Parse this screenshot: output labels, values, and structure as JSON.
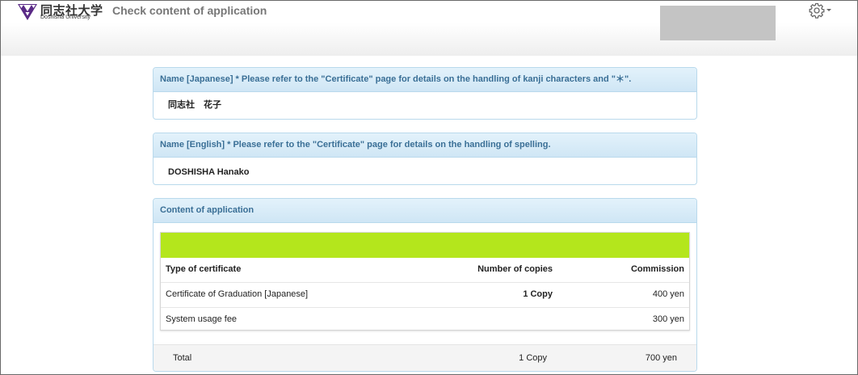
{
  "header": {
    "logo_ja": "同志社大学",
    "logo_en": "Doshisha University",
    "page_title": "Check content of application",
    "settings_icon": "gear-icon"
  },
  "name_japanese": {
    "heading": "Name [Japanese] * Please refer to the \"Certificate\" page for details on the handling of kanji characters and \"＊\".",
    "value": "同志社　花子"
  },
  "name_english": {
    "heading": "Name [English] * Please refer to the \"Certificate\" page for details on the handling of spelling.",
    "value": "DOSHISHA Hanako"
  },
  "application": {
    "heading": "Content of application",
    "columns": [
      "Type of certificate",
      "Number of copies",
      "Commission"
    ],
    "rows": [
      {
        "type": "Certificate of Graduation [Japanese]",
        "copies": "1 Copy",
        "commission": "400 yen"
      },
      {
        "type": "System usage fee",
        "copies": "",
        "commission": "300 yen"
      }
    ],
    "total": {
      "label": "Total",
      "copies": "1 Copy",
      "commission": "700 yen"
    }
  },
  "colors": {
    "accent_green": "#b4e61c",
    "panel_header": "#cfe6f5",
    "panel_header_text": "#3a6f96",
    "logo_purple": "#5a2a86"
  }
}
